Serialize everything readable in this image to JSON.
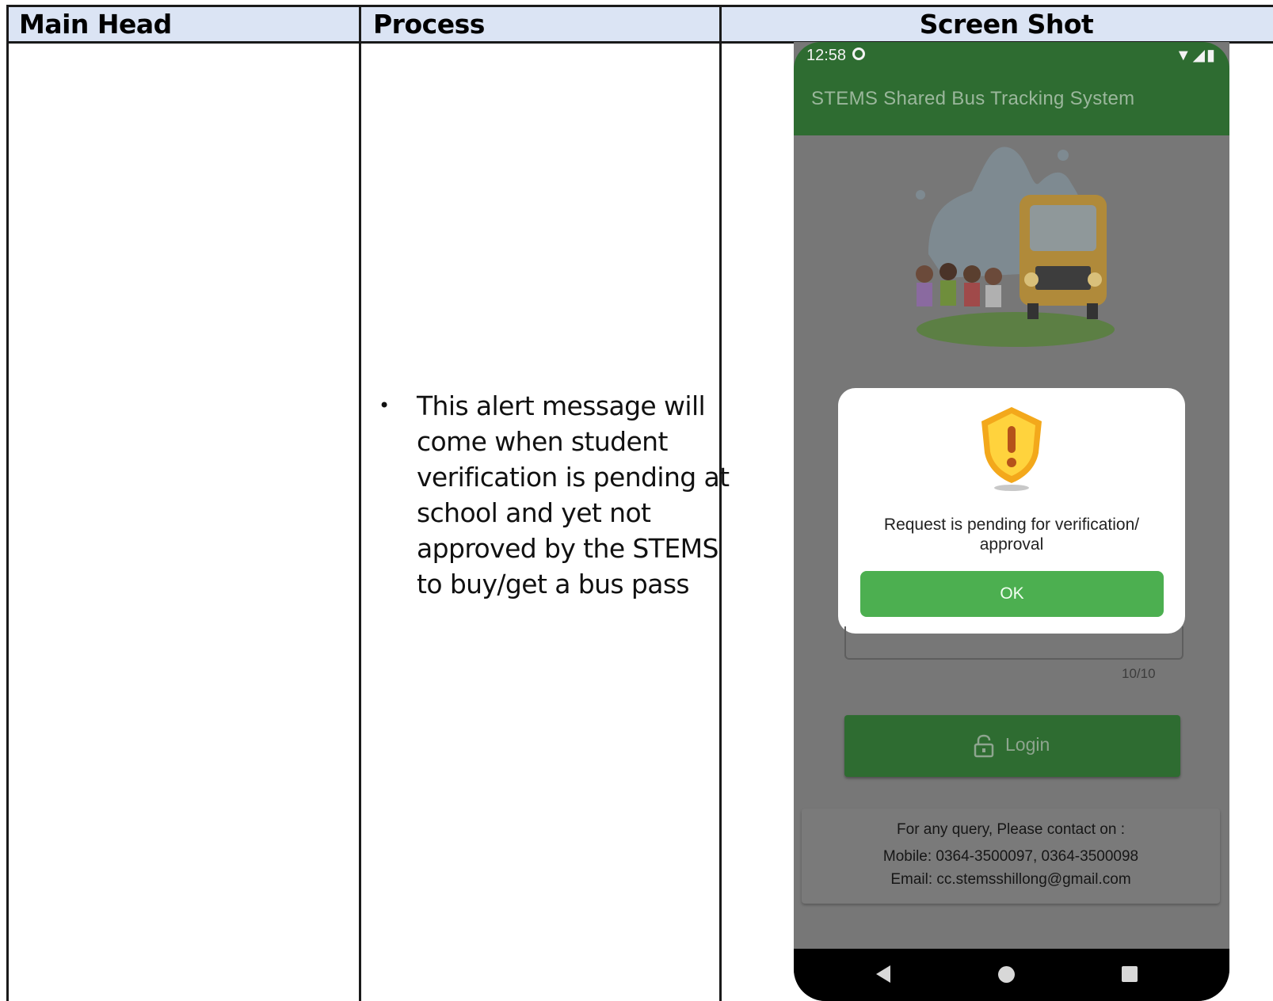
{
  "table": {
    "headers": [
      "Main Head",
      "Process",
      "Screen Shot"
    ],
    "process_points": [
      "This alert message will come when student verification is pending at school and yet not approved by the STEMS to buy/get a bus pass"
    ]
  },
  "phone": {
    "status_time": "12:58",
    "app_title": "STEMS Shared Bus Tracking System",
    "dialog": {
      "message": "Request is pending for verification/ approval",
      "ok_label": "OK"
    },
    "input_counter": "10/10",
    "login_label": "Login",
    "contact": {
      "line1": "For any query, Please contact on :",
      "line2": "Mobile: 0364-3500097, 0364-3500098",
      "line3": "Email: cc.stemsshillong@gmail.com"
    }
  },
  "colors": {
    "header_bg": "#dbe4f4",
    "app_green": "#2e6c31",
    "ok_green": "#4caf50",
    "overlay_gray": "#777777"
  }
}
